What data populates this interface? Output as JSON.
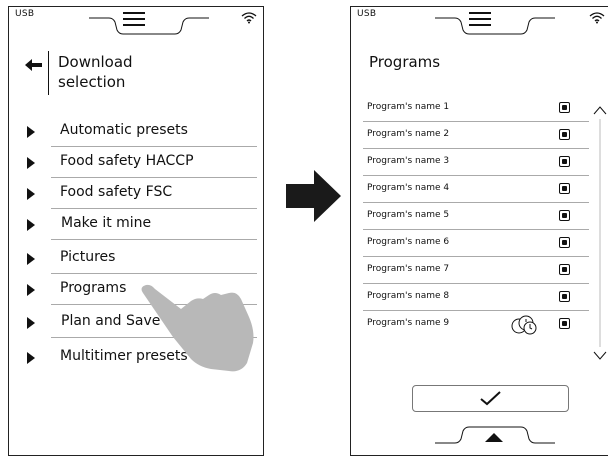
{
  "left": {
    "status": "USB",
    "back_icon": "arrow-left-icon",
    "title": "Download\nselection",
    "menu": [
      {
        "label": "Automatic presets"
      },
      {
        "label": "Food safety HACCP"
      },
      {
        "label": "Food safety FSC"
      },
      {
        "label": "Make it mine"
      },
      {
        "label": "Pictures"
      },
      {
        "label": "Programs"
      },
      {
        "label": "Plan and Save"
      },
      {
        "label": "Multitimer presets"
      }
    ]
  },
  "right": {
    "status": "USB",
    "title": "Programs",
    "programs": [
      {
        "name": "Program's name 1",
        "selected": true
      },
      {
        "name": "Program's name 2",
        "selected": true
      },
      {
        "name": "Program's name 3",
        "selected": true
      },
      {
        "name": "Program's name 4",
        "selected": true
      },
      {
        "name": "Program's name 5",
        "selected": true
      },
      {
        "name": "Program's name 6",
        "selected": true
      },
      {
        "name": "Program's name 7",
        "selected": true
      },
      {
        "name": "Program's name 8",
        "selected": true
      },
      {
        "name": "Program's name 9",
        "selected": true,
        "icon": "multi-clock-icon"
      }
    ],
    "confirm_icon": "checkmark-icon"
  },
  "colors": {
    "ink": "#111111",
    "separator": "#aaaaaa",
    "hand": "#b8b8b8",
    "arrow": "#1a1a1a"
  }
}
